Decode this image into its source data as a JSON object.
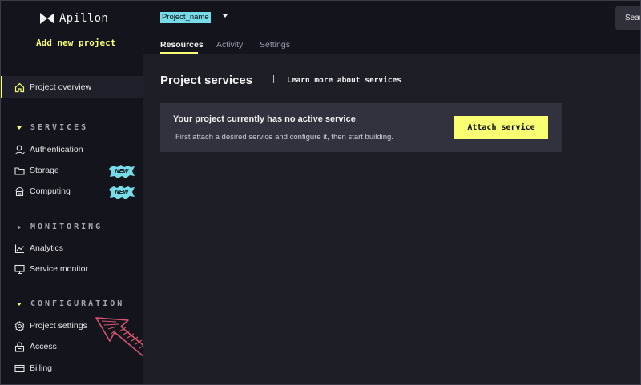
{
  "app": {
    "name": "Apillon"
  },
  "sidebar": {
    "add_project": "Add new project",
    "overview": "Project overview",
    "sections": {
      "services": "SERVICES",
      "monitoring": "MONITORING",
      "configuration": "CONFIGURATION"
    },
    "items": {
      "authentication": "Authentication",
      "storage": "Storage",
      "computing": "Computing",
      "analytics": "Analytics",
      "service_monitor": "Service monitor",
      "project_settings": "Project settings",
      "access": "Access",
      "billing": "Billing"
    },
    "new_badge": "NEW"
  },
  "header": {
    "project_name": "Project_name",
    "tabs": {
      "resources": "Resources",
      "activity": "Activity",
      "settings": "Settings"
    },
    "search_label": "Search"
  },
  "main": {
    "title": "Project services",
    "learn_more": "Learn more about services",
    "card_title": "Your project currently has no active service",
    "card_desc": "First attach a desired service and configure it, then start building.",
    "attach_button": "Attach service"
  },
  "colors": {
    "accent": "#f9ff73",
    "project_highlight": "#78dce8",
    "badge": "#78dce8",
    "annotation_arrow": "#d9536f"
  }
}
